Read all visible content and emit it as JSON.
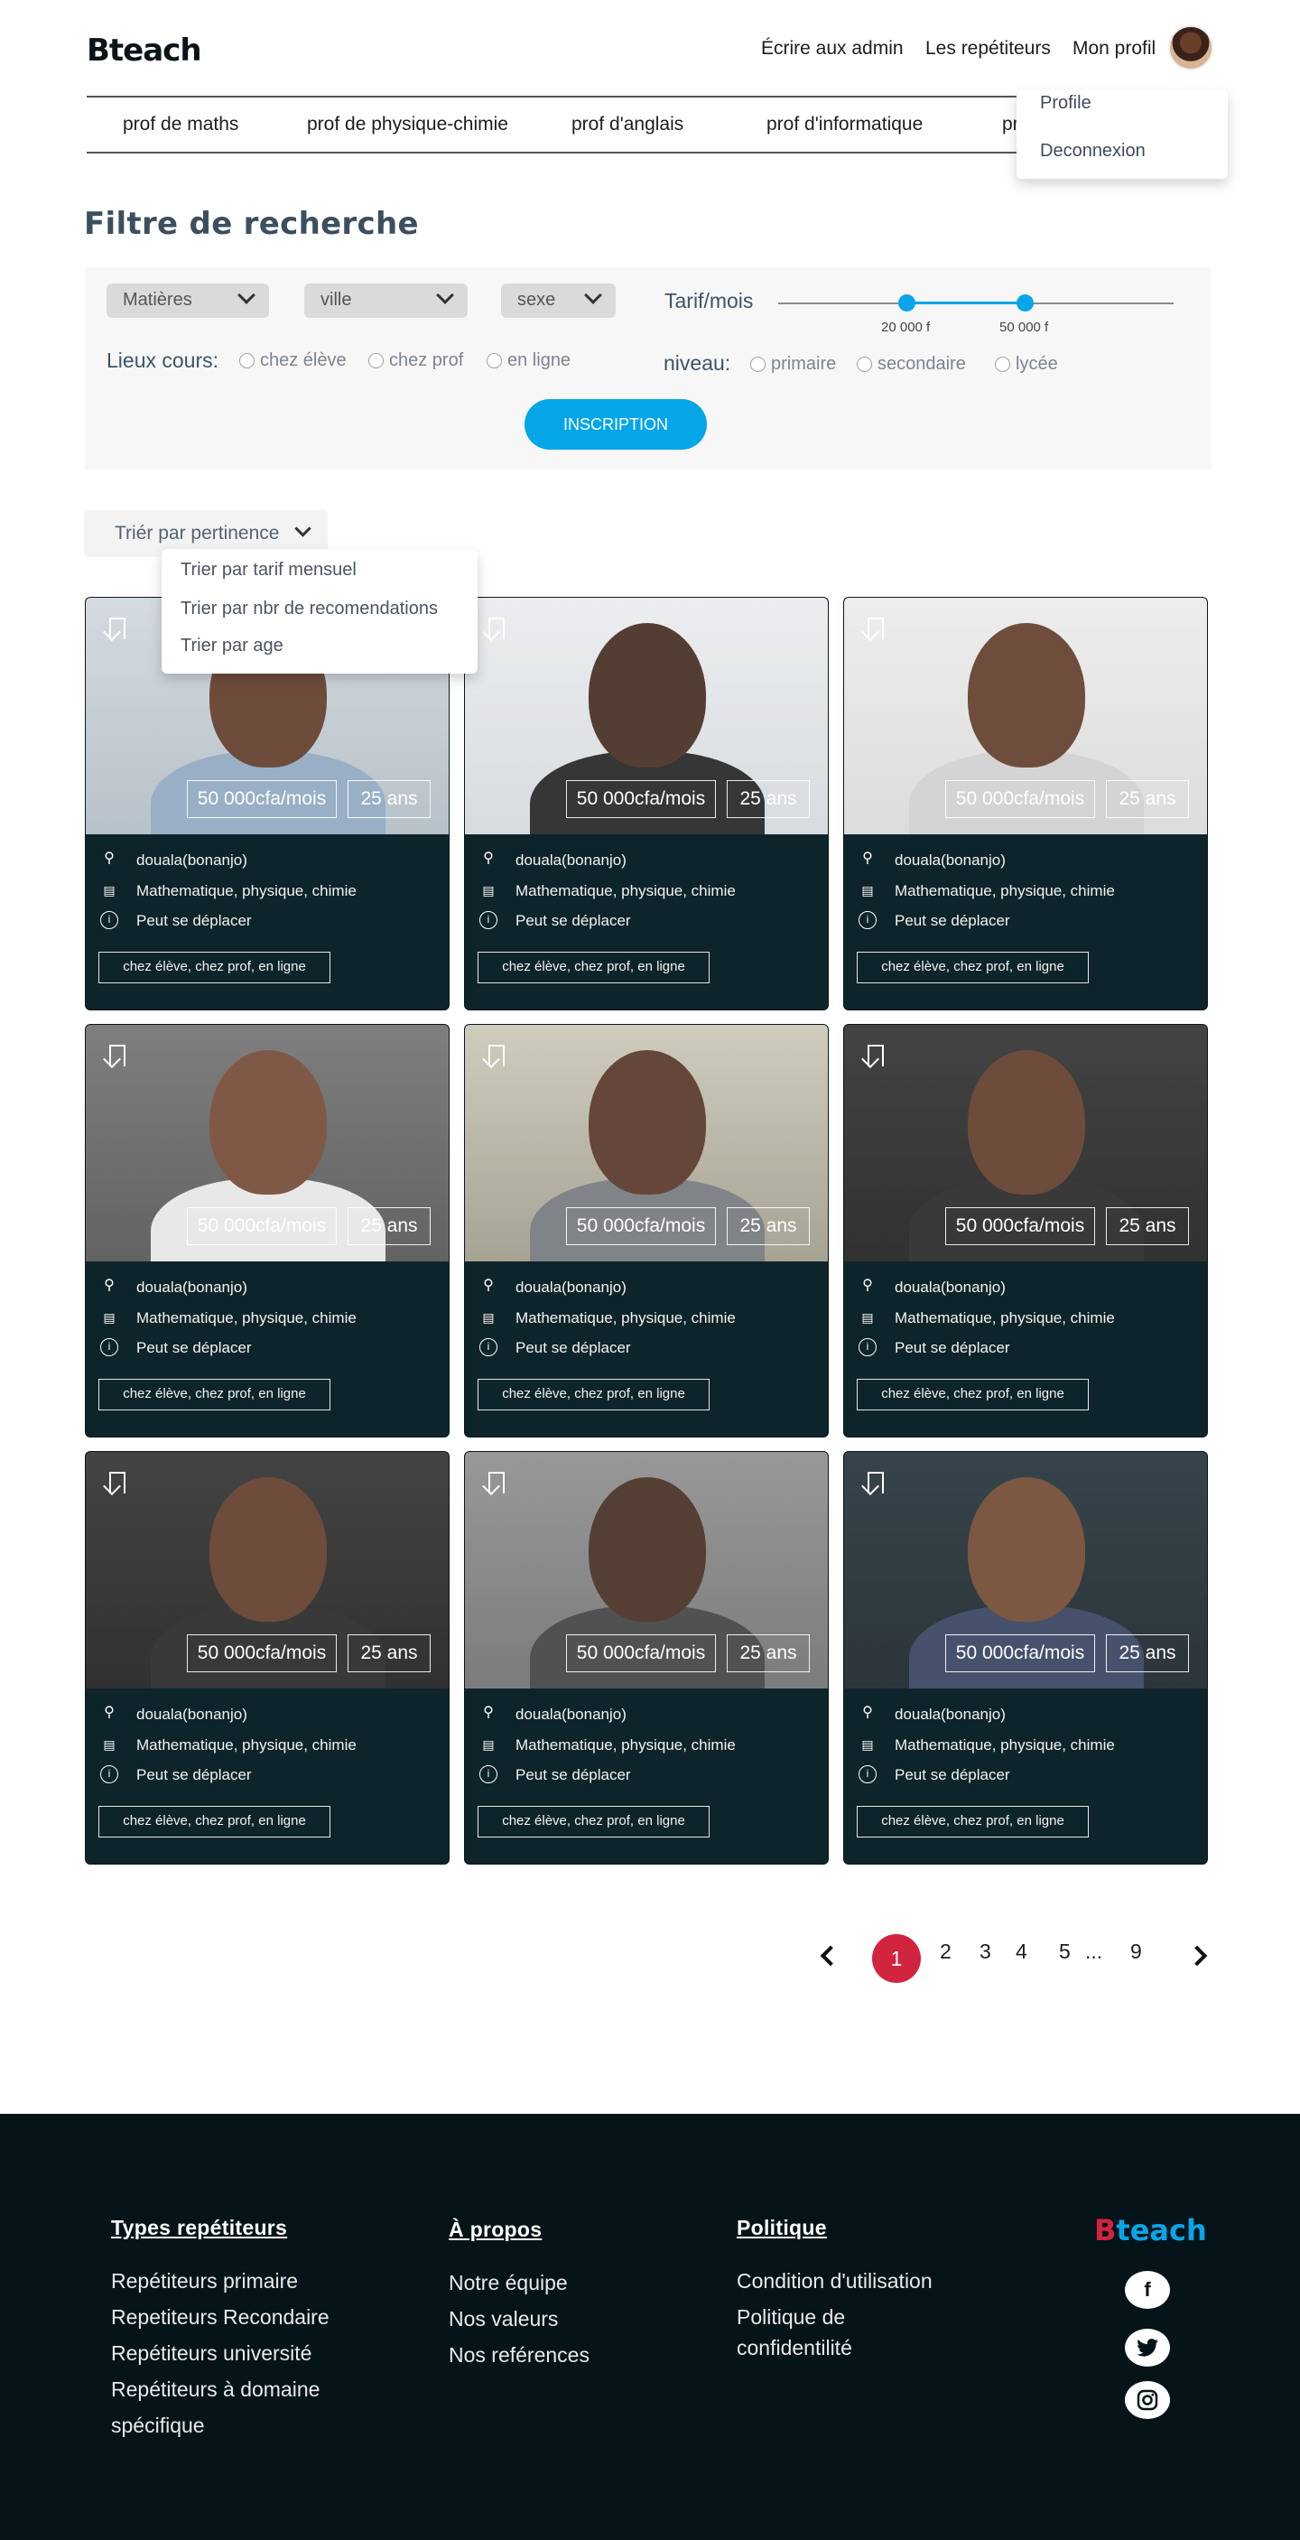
{
  "header": {
    "logo": "Bteach",
    "nav": [
      "Écrire aux admin",
      "Les repétiteurs",
      "Mon profil"
    ]
  },
  "profile_menu": [
    "Profile",
    "Deconnexion"
  ],
  "categories": [
    "prof de maths",
    "prof de physique-chimie",
    "prof d'anglais",
    "prof d'informatique",
    "pr"
  ],
  "filter": {
    "title": "Filtre de recherche",
    "selects": [
      "Matières",
      "ville",
      "sexe"
    ],
    "tarif_label": "Tarif/mois",
    "tarif_min": "20 000 f",
    "tarif_max": "50 000 f",
    "lieux_label": "Lieux cours:",
    "lieux_options": [
      "chez élève",
      "chez prof",
      "en ligne"
    ],
    "niveau_label": "niveau:",
    "niveau_options": [
      "primaire",
      "secondaire",
      "lycée"
    ],
    "submit": "INSCRIPTION"
  },
  "sort": {
    "label": "Triér par pertinence",
    "options": [
      "Trier par tarif mensuel",
      "Trier par nbr de recomendations",
      "Trier par age"
    ]
  },
  "tutors": [
    {
      "price": "50 000cfa/mois",
      "age": "25 ans",
      "city": "douala(bonanjo)",
      "subjects": "Mathematique, physique, chimie",
      "mobility": "Peut se déplacer",
      "locations": "chez élève, chez prof, en ligne"
    },
    {
      "price": "50 000cfa/mois",
      "age": "25 ans",
      "city": "douala(bonanjo)",
      "subjects": "Mathematique, physique, chimie",
      "mobility": "Peut se déplacer",
      "locations": "chez élève, chez prof, en ligne"
    },
    {
      "price": "50 000cfa/mois",
      "age": "25 ans",
      "city": "douala(bonanjo)",
      "subjects": "Mathematique, physique, chimie",
      "mobility": "Peut se déplacer",
      "locations": "chez élève, chez prof, en ligne"
    },
    {
      "price": "50 000cfa/mois",
      "age": "25 ans",
      "city": "douala(bonanjo)",
      "subjects": "Mathematique, physique, chimie",
      "mobility": "Peut se déplacer",
      "locations": "chez élève, chez prof, en ligne"
    },
    {
      "price": "50 000cfa/mois",
      "age": "25 ans",
      "city": "douala(bonanjo)",
      "subjects": "Mathematique, physique, chimie",
      "mobility": "Peut se déplacer",
      "locations": "chez élève, chez prof, en ligne"
    },
    {
      "price": "50 000cfa/mois",
      "age": "25 ans",
      "city": "douala(bonanjo)",
      "subjects": "Mathematique, physique, chimie",
      "mobility": "Peut se déplacer",
      "locations": "chez élève, chez prof, en ligne"
    },
    {
      "price": "50 000cfa/mois",
      "age": "25 ans",
      "city": "douala(bonanjo)",
      "subjects": "Mathematique, physique, chimie",
      "mobility": "Peut se déplacer",
      "locations": "chez élève, chez prof, en ligne"
    },
    {
      "price": "50 000cfa/mois",
      "age": "25 ans",
      "city": "douala(bonanjo)",
      "subjects": "Mathematique, physique, chimie",
      "mobility": "Peut se déplacer",
      "locations": "chez élève, chez prof, en ligne"
    },
    {
      "price": "50 000cfa/mois",
      "age": "25 ans",
      "city": "douala(bonanjo)",
      "subjects": "Mathematique, physique, chimie",
      "mobility": "Peut se déplacer",
      "locations": "chez élève, chez prof, en ligne"
    }
  ],
  "pagination": {
    "active": "1",
    "pages": [
      "2",
      "3",
      "4",
      "5"
    ],
    "ellipsis": "...",
    "last": "9"
  },
  "footer": {
    "col1": {
      "title": "Types repétiteurs",
      "links": [
        "Repétiteurs primaire",
        "Repetiteurs Recondaire",
        "Repétiteurs université",
        "Repétiteurs à domaine",
        "spécifique"
      ]
    },
    "col2": {
      "title": "À propos",
      "links": [
        "Notre équipe",
        "Nos valeurs",
        "Nos reférences"
      ]
    },
    "col3": {
      "title": "Politique",
      "links": [
        "Condition d'utilisation",
        "Politique de",
        "confidentilité"
      ]
    },
    "logo_b": "B",
    "logo_rest": "teach",
    "social": [
      "facebook-icon",
      "twitter-icon",
      "instagram-icon"
    ]
  },
  "colors": {
    "accent": "#05a6e8",
    "brand_red": "#d2233f",
    "card_bg": "#0e242b",
    "footer_bg": "#051419"
  }
}
